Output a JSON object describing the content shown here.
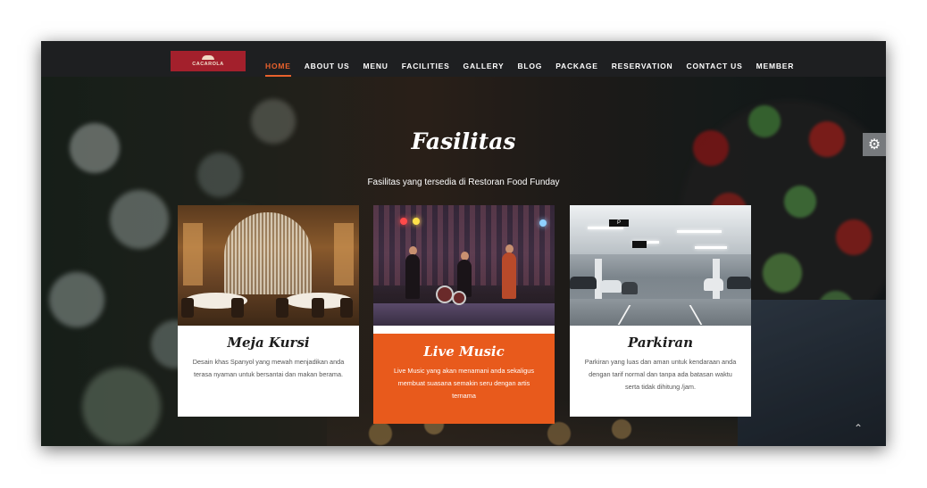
{
  "navbar": {
    "logo_text": "CACAROLA",
    "items": [
      {
        "label": "HOME",
        "active": true
      },
      {
        "label": "ABOUT US",
        "active": false
      },
      {
        "label": "MENU",
        "active": false
      },
      {
        "label": "FACILITIES",
        "active": false
      },
      {
        "label": "GALLERY",
        "active": false
      },
      {
        "label": "BLOG",
        "active": false
      },
      {
        "label": "PACKAGE",
        "active": false
      },
      {
        "label": "RESERVATION",
        "active": false
      },
      {
        "label": "CONTACT US",
        "active": false
      },
      {
        "label": "MEMBER",
        "active": false
      }
    ]
  },
  "section": {
    "title": "Fasilitas",
    "subtitle": "Fasilitas yang tersedia di Restoran Food Funday"
  },
  "cards": [
    {
      "title": "Meja Kursi",
      "description": "Desain khas Spanyol yang mewah menjadikan anda terasa nyaman untuk bersantai dan makan berama.",
      "image": "restaurant-dining-room-photo"
    },
    {
      "title": "Live Music",
      "description": "Live Music yang akan menamani anda sekaligus membuat suasana semakin seru dengan artis ternama",
      "image": "live-band-stage-photo"
    },
    {
      "title": "Parkiran",
      "description": "Parkiran yang luas dan aman untuk kendaraan anda dengan tarif normal dan tanpa ada batasan waktu serta tidak dihitung /jam.",
      "image": "parking-garage-photo"
    }
  ],
  "icons": {
    "settings": "gear-icon",
    "scroll_top": "chevron-up-icon"
  },
  "colors": {
    "accent": "#e85a1c",
    "nav_active": "#e8612c",
    "logo_bg": "#a3202c",
    "navbar_bg": "#1e1f21"
  }
}
